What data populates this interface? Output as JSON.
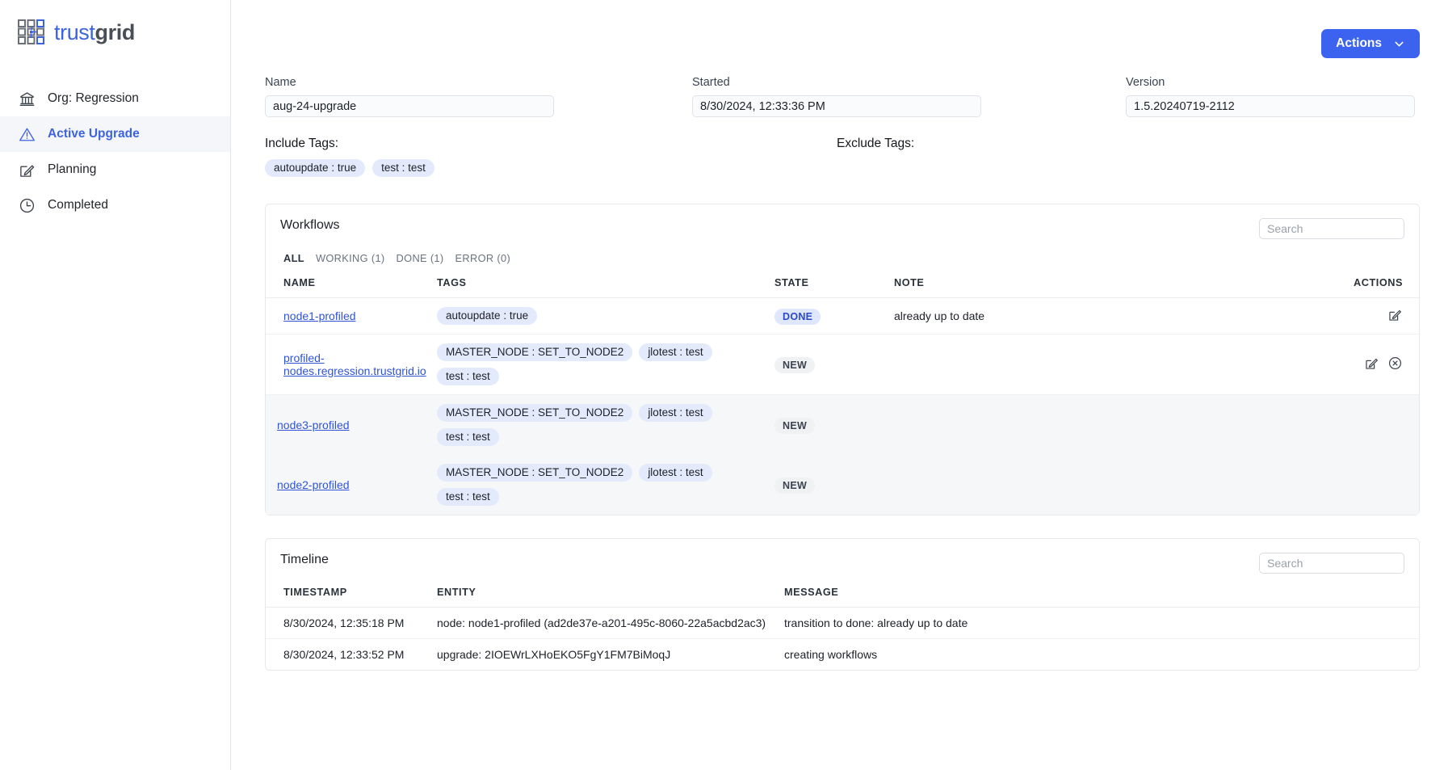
{
  "brand": {
    "name_part1": "trust",
    "name_part2": "grid",
    "logo_icon": "grid-logo-icon",
    "accent_color": "#3d63e0"
  },
  "sidebar": {
    "items": [
      {
        "label": "Org: Regression",
        "icon": "bank-icon",
        "active": false
      },
      {
        "label": "Active Upgrade",
        "icon": "warning-triangle-icon",
        "active": true
      },
      {
        "label": "Planning",
        "icon": "pencil-square-icon",
        "active": false
      },
      {
        "label": "Completed",
        "icon": "clock-icon",
        "active": false
      }
    ]
  },
  "toolbar": {
    "actions_label": "Actions",
    "actions_icon": "chevron-down-icon",
    "actions_color": "#3b63f0"
  },
  "fields": {
    "name": {
      "label": "Name",
      "value": "aug-24-upgrade"
    },
    "started": {
      "label": "Started",
      "value": "8/30/2024, 12:33:36 PM"
    },
    "version": {
      "label": "Version",
      "value": "1.5.20240719-2112"
    }
  },
  "tags": {
    "include_label": "Include Tags:",
    "include": [
      "autoupdate : true",
      "test : test"
    ],
    "exclude_label": "Exclude Tags:",
    "exclude": []
  },
  "workflows": {
    "title": "Workflows",
    "search_placeholder": "Search",
    "filters": [
      {
        "label": "ALL",
        "active": true
      },
      {
        "label": "WORKING (1)",
        "active": false
      },
      {
        "label": "DONE (1)",
        "active": false
      },
      {
        "label": "ERROR (0)",
        "active": false
      }
    ],
    "columns": [
      "NAME",
      "TAGS",
      "STATE",
      "NOTE",
      "ACTIONS"
    ],
    "rows": [
      {
        "name": "node1-profiled",
        "tags": [
          "autoupdate : true"
        ],
        "state": "DONE",
        "state_style": "done",
        "note": "already up to date",
        "child": false,
        "actions": [
          "edit-icon"
        ]
      },
      {
        "name": "profiled-nodes.regression.trustgrid.io",
        "tags": [
          "MASTER_NODE : SET_TO_NODE2",
          "jlotest : test",
          "test : test"
        ],
        "state": "NEW",
        "state_style": "new",
        "note": "",
        "child": false,
        "actions": [
          "edit-icon",
          "cancel-circle-icon"
        ]
      },
      {
        "name": "node3-profiled",
        "tags": [
          "MASTER_NODE : SET_TO_NODE2",
          "jlotest : test",
          "test : test"
        ],
        "state": "NEW",
        "state_style": "new",
        "note": "",
        "child": true,
        "actions": []
      },
      {
        "name": "node2-profiled",
        "tags": [
          "MASTER_NODE : SET_TO_NODE2",
          "jlotest : test",
          "test : test"
        ],
        "state": "NEW",
        "state_style": "new",
        "note": "",
        "child": true,
        "actions": []
      }
    ]
  },
  "timeline": {
    "title": "Timeline",
    "search_placeholder": "Search",
    "columns": [
      "TIMESTAMP",
      "ENTITY",
      "MESSAGE"
    ],
    "rows": [
      {
        "timestamp": "8/30/2024, 12:35:18 PM",
        "entity": "node: node1-profiled (ad2de37e-a201-495c-8060-22a5acbd2ac3)",
        "message": "transition to done: already up to date"
      },
      {
        "timestamp": "8/30/2024, 12:33:52 PM",
        "entity": "upgrade: 2IOEWrLXHoEKO5FgY1FM7BiMoqJ",
        "message": "creating workflows"
      }
    ]
  }
}
